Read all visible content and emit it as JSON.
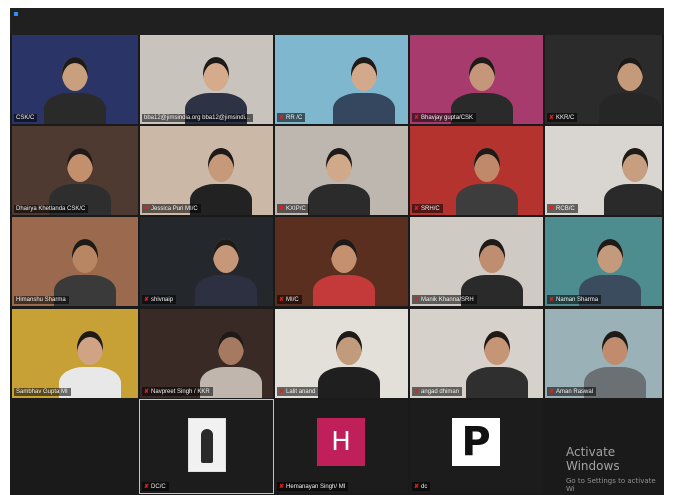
{
  "meeting": {
    "participants": [
      {
        "id": "p1",
        "label": "CSK/C",
        "muted": false,
        "bg": "#2b3466",
        "skin": "#c9a07d",
        "shirt": "#2a2a2a"
      },
      {
        "id": "p2",
        "label": "bba12@jimsindia.org bba12@jimsindi...",
        "muted": false,
        "bg": "#c8c3bd",
        "skin": "#d5ab8c",
        "shirt": "#2d3345"
      },
      {
        "id": "p3",
        "label": "RR /C",
        "muted": true,
        "bg": "#7fb7cf",
        "skin": "#d2a98a",
        "shirt": "#34475e"
      },
      {
        "id": "p4",
        "label": "Bhavjay gupta/CSK",
        "muted": true,
        "bg": "#a83b6e",
        "skin": "#c59679",
        "shirt": "#2a2a2a"
      },
      {
        "id": "p5",
        "label": "KKR/C",
        "muted": true,
        "bg": "#2b2b2b",
        "skin": "#c49a7a",
        "shirt": "#262626"
      },
      {
        "id": "p6",
        "label": "Dhairya Khetlanda CSK/C",
        "muted": false,
        "bg": "#4e3a30",
        "skin": "#c48f6c",
        "shirt": "#2e2e2e"
      },
      {
        "id": "p7",
        "label": "Jessica Puri MI/C",
        "muted": true,
        "bg": "#cbb8a7",
        "skin": "#c5997a",
        "shirt": "#222222"
      },
      {
        "id": "p8",
        "label": "KXIP/C",
        "muted": true,
        "bg": "#bdb7b0",
        "skin": "#d0a88a",
        "shirt": "#2b2b2b"
      },
      {
        "id": "p9",
        "label": "SRH/C",
        "muted": true,
        "bg": "#b4332f",
        "skin": "#c08a6a",
        "shirt": "#3d3d3d"
      },
      {
        "id": "p10",
        "label": "RCB/C",
        "muted": true,
        "bg": "#d9d6d2",
        "skin": "#c79e80",
        "shirt": "#2a2a2a"
      },
      {
        "id": "p11",
        "label": "Himanshu Sharma",
        "muted": false,
        "bg": "#9b6a4e",
        "skin": "#b98664",
        "shirt": "#3a3a3a"
      },
      {
        "id": "p12",
        "label": "shivnaip",
        "muted": true,
        "bg": "#24272b",
        "skin": "#c7977a",
        "shirt": "#2d3040"
      },
      {
        "id": "p13",
        "label": "MI/C",
        "muted": true,
        "bg": "#5a2f20",
        "skin": "#c4906f",
        "shirt": "#c43a3a"
      },
      {
        "id": "p14",
        "label": "Manik Khanna/SRH",
        "muted": true,
        "bg": "#cfcac4",
        "skin": "#bf8e70",
        "shirt": "#2a2a2a"
      },
      {
        "id": "p15",
        "label": "Naman Sharma",
        "muted": true,
        "bg": "#4d8c8f",
        "skin": "#c49a7c",
        "shirt": "#3a4c5e"
      },
      {
        "id": "p16",
        "label": "Sambhav Gupta MI",
        "muted": false,
        "bg": "#c7a136",
        "skin": "#d1a385",
        "shirt": "#e8e8e8"
      },
      {
        "id": "p17",
        "label": "Navpreet Singh / KKR",
        "muted": true,
        "bg": "#3a2a26",
        "skin": "#a57a60",
        "shirt": "#c0b6ae"
      },
      {
        "id": "p18",
        "label": "Lalit anand",
        "muted": true,
        "bg": "#e3dfd9",
        "skin": "#c29a7c",
        "shirt": "#1f1f1f"
      },
      {
        "id": "p19",
        "label": "angad dhiman",
        "muted": true,
        "bg": "#d6d2cb",
        "skin": "#c59576",
        "shirt": "#2f2f2f"
      },
      {
        "id": "p20",
        "label": "Aman Raswal",
        "muted": true,
        "bg": "#9bb1b8",
        "skin": "#c08c6d",
        "shirt": "#6a7074"
      }
    ],
    "bottom_row": [
      {
        "id": "b1",
        "label": "DC/C",
        "muted": true,
        "kind": "photo"
      },
      {
        "id": "b2",
        "label": "Hemanayan Singh/ MI",
        "muted": true,
        "kind": "letter",
        "letter": "H",
        "box_bg": "#c01f5a",
        "fg": "#ffffff"
      },
      {
        "id": "b3",
        "label": "dc",
        "muted": true,
        "kind": "letter",
        "letter": "P",
        "box_bg": "#ffffff",
        "fg": "#111111"
      }
    ],
    "watermark": {
      "line1": "Activate Windows",
      "line2": "Go to Settings to activate Wi"
    },
    "colors": {
      "accent": "#2d8cff",
      "mute_icon": "#e02020",
      "active_speaker_border": "#c7d46a"
    }
  }
}
